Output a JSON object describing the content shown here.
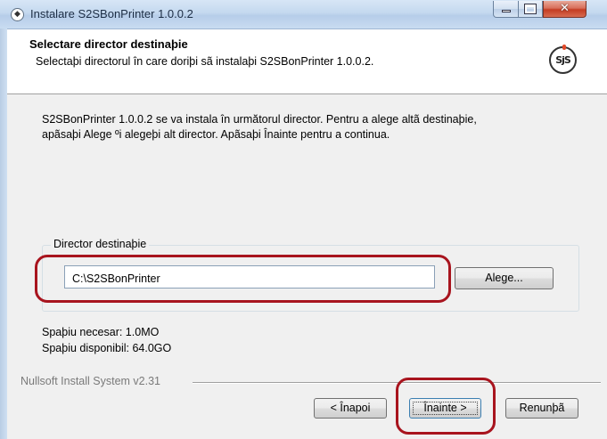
{
  "window": {
    "title": "Instalare S2SBonPrinter 1.0.0.2",
    "controls": {
      "minimize": "minimize-icon",
      "maximize": "maximize-icon",
      "close": "✕"
    }
  },
  "header": {
    "title": "Selectare director destinaþie",
    "subtitle": "Selectaþi directorul în care doriþi sã instalaþi S2SBonPrinter 1.0.0.2.",
    "logo_text": "SjS"
  },
  "body": {
    "intro_line1": "S2SBonPrinter 1.0.0.2 se va instala în următorul director. Pentru a alege altã destinaþie,",
    "intro_line2": "apãsaþi Alege ºi alegeþi alt director. Apãsaþi Înainte pentru a continua."
  },
  "destination": {
    "legend": "Director destinaþie",
    "path_value": "C:\\S2SBonPrinter",
    "browse_label": "Alege..."
  },
  "space": {
    "required": "Spaþiu necesar: 1.0MO",
    "available": "Spaþiu disponibil: 64.0GO"
  },
  "footer": {
    "brand": "Nullsoft Install System v2.31",
    "back_label": "< Înapoi",
    "next_label": "Înainte >",
    "cancel_label": "Renunþã"
  },
  "colors": {
    "annotation": "#a8141e",
    "titlebar": "#c4d8ef"
  }
}
